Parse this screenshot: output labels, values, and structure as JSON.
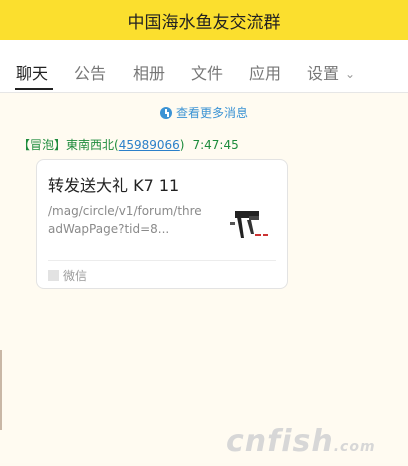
{
  "window": {
    "title": "中国海水鱼友交流群"
  },
  "tabs": [
    {
      "label": "聊天",
      "active": true
    },
    {
      "label": "公告"
    },
    {
      "label": "相册"
    },
    {
      "label": "文件"
    },
    {
      "label": "应用"
    },
    {
      "label": "设置"
    }
  ],
  "history": {
    "label": "查看更多消息",
    "icon": "clock-icon"
  },
  "message": {
    "role_tag": "【冒泡】",
    "sender": "東南西北",
    "uid_open": "(",
    "uid": "45989066",
    "uid_close": ")",
    "time": "7:47:45",
    "card": {
      "title": "转发送大礼 K7 11",
      "url": "/mag/circle/v1/forum/threadWapPage?tid=8...",
      "source": "微信"
    }
  },
  "watermark": {
    "text": "cnfish",
    "suffix": ".com"
  },
  "colors": {
    "titlebar": "#fbdf2e",
    "link": "#3b93d4",
    "sender": "#1d8b3c",
    "phone": "#f5a623"
  }
}
